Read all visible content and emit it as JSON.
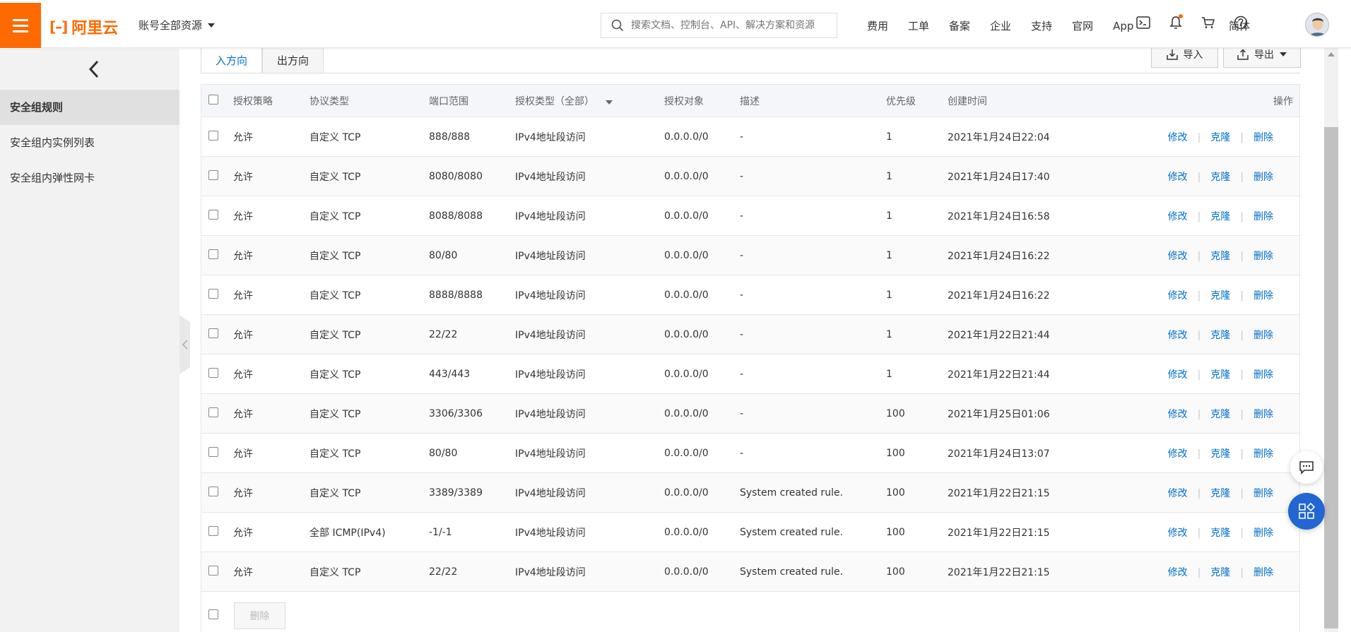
{
  "header": {
    "logo_text": "阿里云",
    "account_label": "账号全部资源",
    "search_placeholder": "搜索文档、控制台、API、解决方案和资源",
    "nav": [
      "费用",
      "工单",
      "备案",
      "企业",
      "支持",
      "官网",
      "App"
    ],
    "icons": [
      "terminal-icon",
      "bell-icon",
      "cart-icon",
      "help-icon"
    ],
    "lang": "简体",
    "accent": "#ff6a00"
  },
  "sidebar": {
    "items": [
      {
        "label": "安全组规则",
        "active": true
      },
      {
        "label": "安全组内实例列表",
        "active": false
      },
      {
        "label": "安全组内弹性网卡",
        "active": false
      }
    ]
  },
  "tabs": [
    {
      "label": "入方向",
      "active": true
    },
    {
      "label": "出方向",
      "active": false
    }
  ],
  "toolbar": {
    "import_label": "导入",
    "export_label": "导出"
  },
  "table": {
    "headers": {
      "policy": "授权策略",
      "protocol": "协议类型",
      "port": "端口范围",
      "auth_type": "授权类型（全部）",
      "object": "授权对象",
      "desc": "描述",
      "priority": "优先级",
      "created": "创建时间",
      "ops": "操作"
    },
    "actions": {
      "edit": "修改",
      "clone": "克隆",
      "delete": "删除"
    },
    "rows": [
      {
        "policy": "允许",
        "protocol": "自定义 TCP",
        "port": "888/888",
        "auth_type": "IPv4地址段访问",
        "object": "0.0.0.0/0",
        "desc": "-",
        "priority": "1",
        "created": "2021年1月24日22:04"
      },
      {
        "policy": "允许",
        "protocol": "自定义 TCP",
        "port": "8080/8080",
        "auth_type": "IPv4地址段访问",
        "object": "0.0.0.0/0",
        "desc": "-",
        "priority": "1",
        "created": "2021年1月24日17:40"
      },
      {
        "policy": "允许",
        "protocol": "自定义 TCP",
        "port": "8088/8088",
        "auth_type": "IPv4地址段访问",
        "object": "0.0.0.0/0",
        "desc": "-",
        "priority": "1",
        "created": "2021年1月24日16:58"
      },
      {
        "policy": "允许",
        "protocol": "自定义 TCP",
        "port": "80/80",
        "auth_type": "IPv4地址段访问",
        "object": "0.0.0.0/0",
        "desc": "-",
        "priority": "1",
        "created": "2021年1月24日16:22"
      },
      {
        "policy": "允许",
        "protocol": "自定义 TCP",
        "port": "8888/8888",
        "auth_type": "IPv4地址段访问",
        "object": "0.0.0.0/0",
        "desc": "-",
        "priority": "1",
        "created": "2021年1月24日16:22"
      },
      {
        "policy": "允许",
        "protocol": "自定义 TCP",
        "port": "22/22",
        "auth_type": "IPv4地址段访问",
        "object": "0.0.0.0/0",
        "desc": "-",
        "priority": "1",
        "created": "2021年1月22日21:44"
      },
      {
        "policy": "允许",
        "protocol": "自定义 TCP",
        "port": "443/443",
        "auth_type": "IPv4地址段访问",
        "object": "0.0.0.0/0",
        "desc": "-",
        "priority": "1",
        "created": "2021年1月22日21:44"
      },
      {
        "policy": "允许",
        "protocol": "自定义 TCP",
        "port": "3306/3306",
        "auth_type": "IPv4地址段访问",
        "object": "0.0.0.0/0",
        "desc": "-",
        "priority": "100",
        "created": "2021年1月25日01:06"
      },
      {
        "policy": "允许",
        "protocol": "自定义 TCP",
        "port": "80/80",
        "auth_type": "IPv4地址段访问",
        "object": "0.0.0.0/0",
        "desc": "-",
        "priority": "100",
        "created": "2021年1月24日13:07"
      },
      {
        "policy": "允许",
        "protocol": "自定义 TCP",
        "port": "3389/3389",
        "auth_type": "IPv4地址段访问",
        "object": "0.0.0.0/0",
        "desc": "System created rule.",
        "priority": "100",
        "created": "2021年1月22日21:15"
      },
      {
        "policy": "允许",
        "protocol": "全部 ICMP(IPv4)",
        "port": "-1/-1",
        "auth_type": "IPv4地址段访问",
        "object": "0.0.0.0/0",
        "desc": "System created rule.",
        "priority": "100",
        "created": "2021年1月22日21:15"
      },
      {
        "policy": "允许",
        "protocol": "自定义 TCP",
        "port": "22/22",
        "auth_type": "IPv4地址段访问",
        "object": "0.0.0.0/0",
        "desc": "System created rule.",
        "priority": "100",
        "created": "2021年1月22日21:15"
      }
    ],
    "footer_delete_label": "删除"
  },
  "link_color": "#0070cc"
}
